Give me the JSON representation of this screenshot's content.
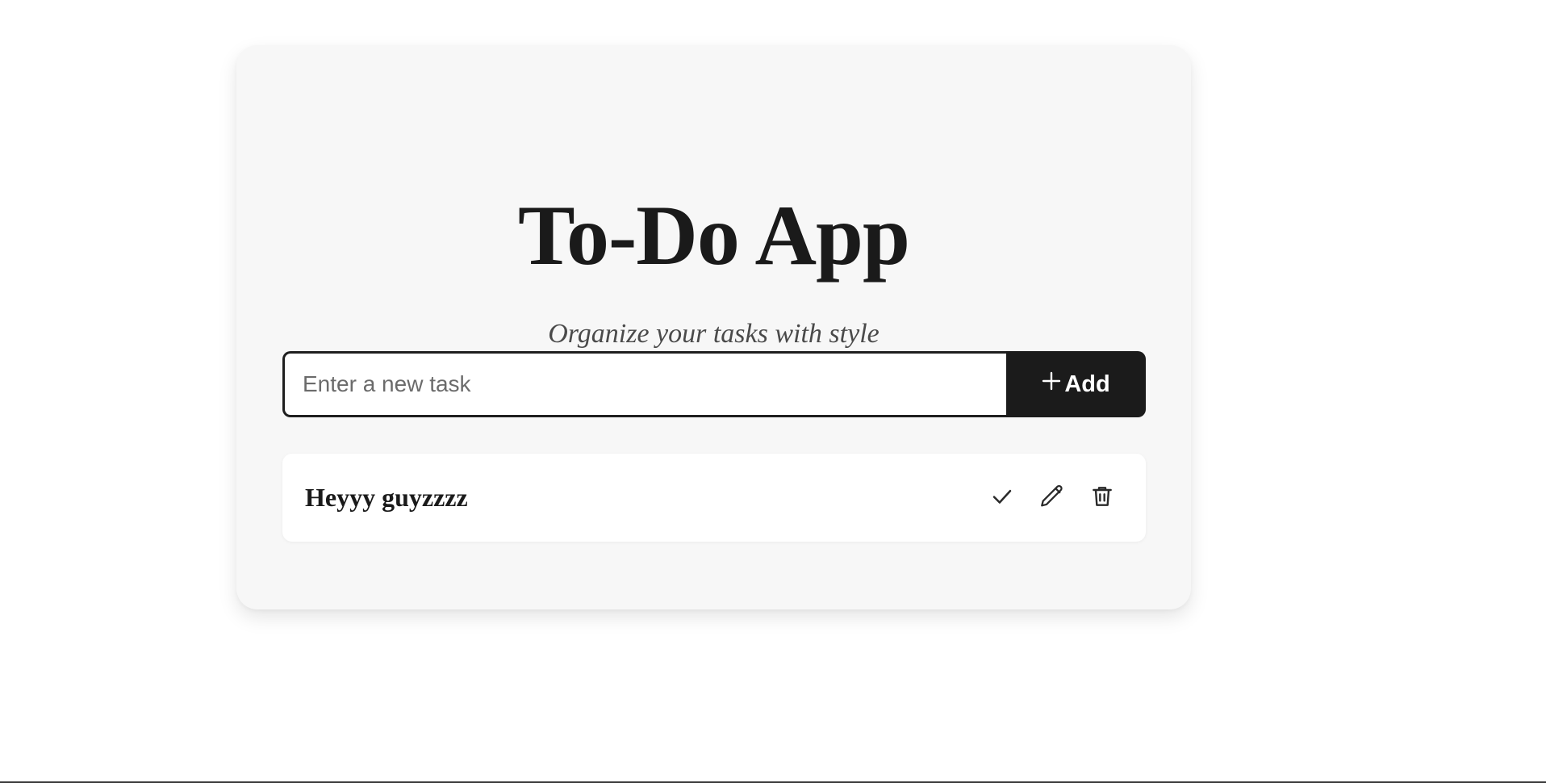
{
  "app": {
    "title": "To-Do App",
    "subtitle": "Organize your tasks with style"
  },
  "new_task": {
    "placeholder": "Enter a new task",
    "value": "",
    "add_label": "Add",
    "add_icon": "plus-icon"
  },
  "tasks": [
    {
      "text": "Heyyy guyzzzz",
      "actions": [
        "check-icon",
        "pencil-icon",
        "trash-icon"
      ]
    }
  ],
  "colors": {
    "card_background": "#f7f7f7",
    "accent_dark": "#1b1b1b",
    "text_primary": "#1a1a1a",
    "text_secondary": "#4a4a4a"
  }
}
